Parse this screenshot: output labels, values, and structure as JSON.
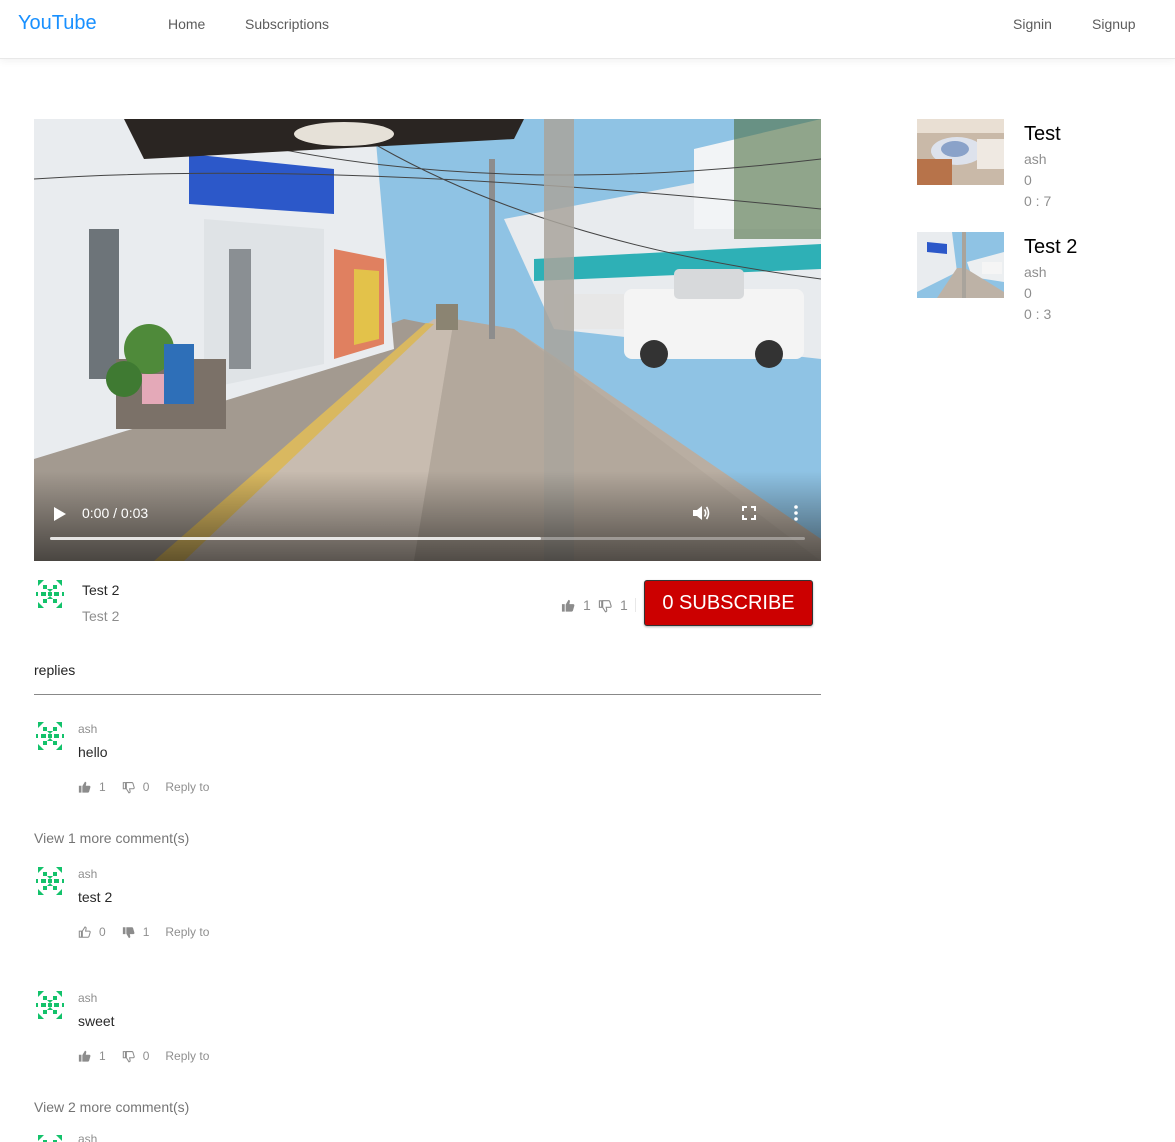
{
  "header": {
    "logo": "YouTube",
    "nav": [
      "Home",
      "Subscriptions"
    ],
    "auth": [
      "Signin",
      "Signup"
    ]
  },
  "player": {
    "time": "0:00 / 0:03",
    "progress": 0.65
  },
  "video": {
    "title": "Test 2",
    "description": "Test 2",
    "likes": "1",
    "dislikes": "1",
    "subscribe_label": "0 SUBSCRIBE",
    "subscribe_color": "#cc0000"
  },
  "replies_label": "replies",
  "comments": [
    {
      "author": "ash",
      "text": "hello",
      "likes": "1",
      "dislikes": "0",
      "reply": "Reply to"
    },
    {
      "author": "ash",
      "text": "test 2",
      "likes": "0",
      "dislikes": "1",
      "reply": "Reply to"
    },
    {
      "author": "ash",
      "text": "sweet",
      "likes": "1",
      "dislikes": "0",
      "reply": "Reply to"
    },
    {
      "author": "ash"
    }
  ],
  "view_more": [
    "View 1 more comment(s)",
    "View 2 more comment(s)"
  ],
  "sidebar": [
    {
      "title": "Test",
      "author": "ash",
      "views": "0",
      "duration": "0 : 7"
    },
    {
      "title": "Test 2",
      "author": "ash",
      "views": "0",
      "duration": "0 : 3"
    }
  ],
  "icons": {
    "like": "thumbs-up-icon",
    "dislike": "thumbs-down-icon",
    "play": "play-icon",
    "volume": "volume-icon",
    "fullscreen": "fullscreen-icon",
    "more": "more-vert-icon",
    "avatar": "identicon-avatar"
  },
  "colors": {
    "brand": "#1890ff",
    "avatar": "#13c26b"
  }
}
